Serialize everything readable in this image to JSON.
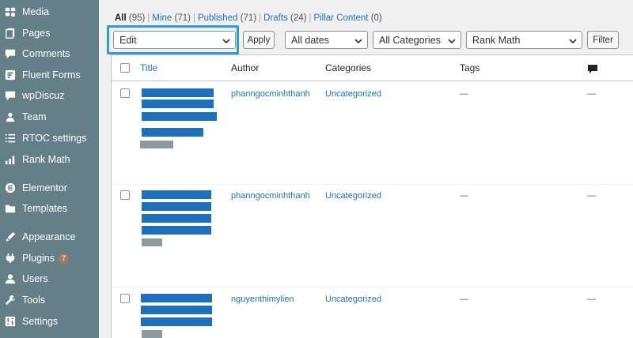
{
  "sidebar": {
    "items": [
      {
        "label": "Media",
        "icon": "media-icon"
      },
      {
        "label": "Pages",
        "icon": "pages-icon"
      },
      {
        "label": "Comments",
        "icon": "comments-icon"
      },
      {
        "label": "Fluent Forms",
        "icon": "fluent-forms-icon"
      },
      {
        "label": "wpDiscuz",
        "icon": "wpdiscuz-icon"
      },
      {
        "label": "Team",
        "icon": "team-icon"
      },
      {
        "label": "RTOC settings",
        "icon": "list-icon"
      },
      {
        "label": "Rank Math",
        "icon": "rank-math-icon"
      },
      {
        "label": "Elementor",
        "icon": "elementor-icon"
      },
      {
        "label": "Templates",
        "icon": "folder-icon"
      },
      {
        "label": "Appearance",
        "icon": "appearance-icon"
      },
      {
        "label": "Plugins",
        "icon": "plugins-icon",
        "badge": "7"
      },
      {
        "label": "Users",
        "icon": "users-icon"
      },
      {
        "label": "Tools",
        "icon": "tools-icon"
      },
      {
        "label": "Settings",
        "icon": "settings-icon"
      }
    ]
  },
  "filters": {
    "all": {
      "label": "All",
      "count": "(95)"
    },
    "mine": {
      "label": "Mine",
      "count": "(71)"
    },
    "published": {
      "label": "Published",
      "count": "(71)"
    },
    "drafts": {
      "label": "Drafts",
      "count": "(24)"
    },
    "pillar": {
      "label": "Pillar Content",
      "count": "(0)"
    },
    "separator": "|"
  },
  "tablenav": {
    "bulk_action": "Edit",
    "apply_label": "Apply",
    "dates": "All dates",
    "categories": "All Categories",
    "rank_math": "Rank Math",
    "filter_label": "Filter"
  },
  "table": {
    "headers": {
      "title": "Title",
      "author": "Author",
      "categories": "Categories",
      "tags": "Tags"
    },
    "rows": [
      {
        "author": "phanngocminhthanh",
        "category": "Uncategorized",
        "tags": "—",
        "comments": "—"
      },
      {
        "author": "phanngocminhthanh",
        "category": "Uncategorized",
        "tags": "—",
        "comments": "—"
      },
      {
        "author": "nguyenthimylien",
        "category": "Uncategorized",
        "tags": "—",
        "comments": "—"
      }
    ]
  },
  "colors": {
    "sidebar_bg": "#647f88",
    "link": "#2271b1",
    "highlight": "#2e9bd9",
    "redaction": "#1f70ba"
  }
}
